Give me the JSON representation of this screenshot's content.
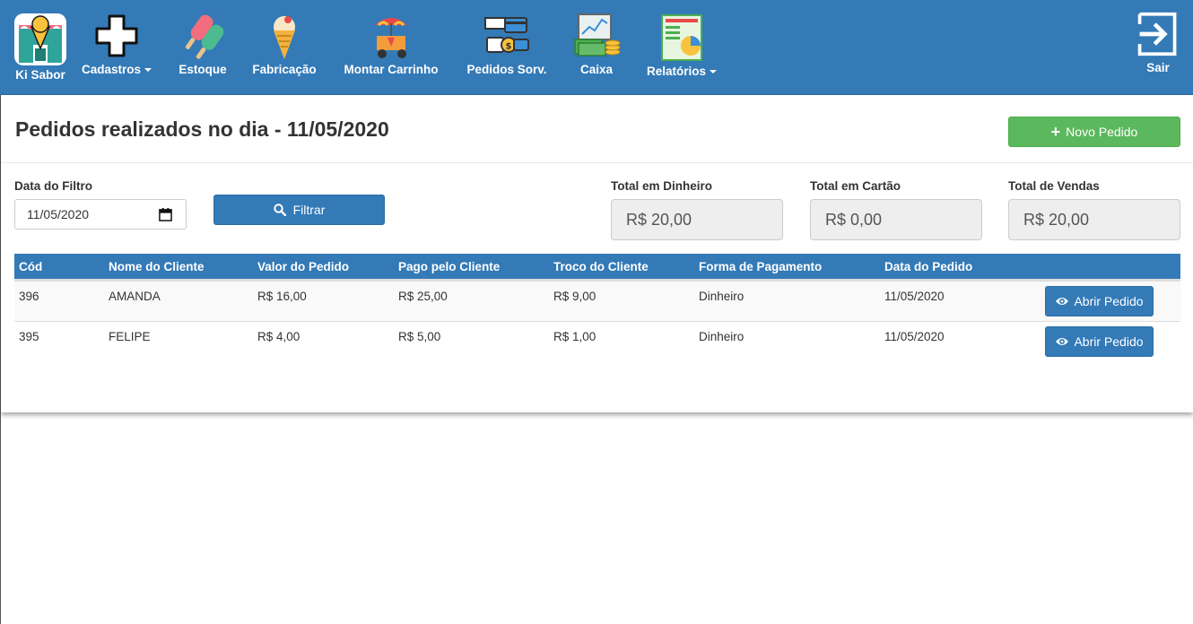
{
  "nav": {
    "brand": "Ki Sabor",
    "items": [
      {
        "label": "Cadastros",
        "icon": "plus-icon",
        "dropdown": true
      },
      {
        "label": "Estoque",
        "icon": "popsicle-icon",
        "dropdown": false
      },
      {
        "label": "Fabricação",
        "icon": "ice-cream-cone-icon",
        "dropdown": false
      },
      {
        "label": "Montar Carrinho",
        "icon": "ice-cream-cart-icon",
        "dropdown": false
      },
      {
        "label": "Pedidos Sorv.",
        "icon": "payment-cards-icon",
        "dropdown": false
      },
      {
        "label": "Caixa",
        "icon": "cash-register-icon",
        "dropdown": false
      },
      {
        "label": "Relatórios",
        "icon": "report-chart-icon",
        "dropdown": true
      }
    ],
    "logout": "Sair"
  },
  "page": {
    "title": "Pedidos realizados no dia - 11/05/2020",
    "new_order_label": "Novo Pedido"
  },
  "filter": {
    "date_label": "Data do Filtro",
    "date_value": "11/05/2020",
    "filter_button": "Filtrar"
  },
  "totals": {
    "cash_label": "Total em Dinheiro",
    "cash_value": "R$ 20,00",
    "card_label": "Total em Cartão",
    "card_value": "R$ 0,00",
    "sales_label": "Total de Vendas",
    "sales_value": "R$ 20,00"
  },
  "table": {
    "headers": [
      "Cód",
      "Nome do Cliente",
      "Valor do Pedido",
      "Pago pelo Cliente",
      "Troco do Cliente",
      "Forma de Pagamento",
      "Data do Pedido"
    ],
    "rows": [
      {
        "cod": "396",
        "cliente": "AMANDA",
        "valor": "R$ 16,00",
        "pago": "R$ 25,00",
        "troco": "R$ 9,00",
        "forma": "Dinheiro",
        "data": "11/05/2020",
        "action": "Abrir Pedido"
      },
      {
        "cod": "395",
        "cliente": "FELIPE",
        "valor": "R$ 4,00",
        "pago": "R$ 5,00",
        "troco": "R$ 1,00",
        "forma": "Dinheiro",
        "data": "11/05/2020",
        "action": "Abrir Pedido"
      }
    ]
  },
  "colors": {
    "primary": "#337ab7",
    "success": "#5cb85c"
  }
}
